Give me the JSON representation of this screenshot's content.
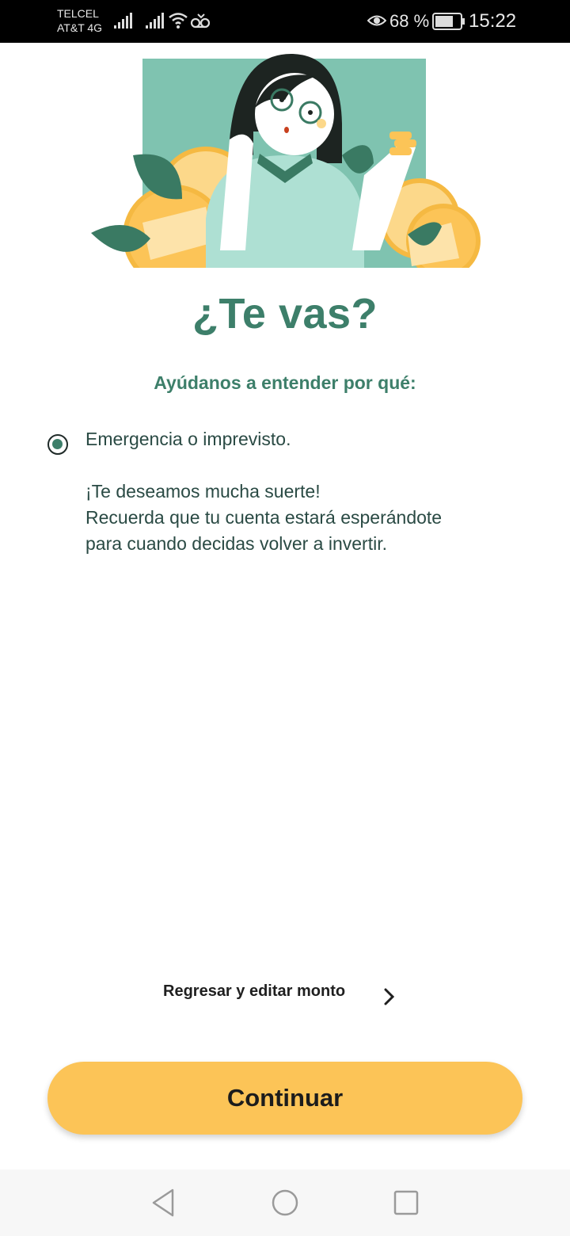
{
  "status_bar": {
    "carrier_1": "TELCEL",
    "carrier_2": "AT&T 4G",
    "battery_percent": "68 %",
    "time": "15:22",
    "icons": [
      "signal-icon",
      "signal-icon",
      "wifi-icon",
      "voicemail-icon",
      "eye-icon",
      "battery-icon"
    ]
  },
  "header": {
    "title": "¿Te vas?",
    "subtitle": "Ayúdanos a entender por qué:"
  },
  "option": {
    "label": "Emergencia o imprevisto.",
    "selected": true
  },
  "message": {
    "line1": "¡Te deseamos mucha suerte!",
    "line2": "Recuerda que tu cuenta estará esperándote",
    "line3": "para cuando decidas volver a invertir."
  },
  "back_link": {
    "label": "Regresar y editar monto",
    "icon": "chevron-right-icon"
  },
  "continue_button": {
    "label": "Continuar"
  },
  "nav": {
    "icons": [
      "back-icon",
      "home-icon",
      "recents-icon"
    ]
  },
  "colors": {
    "brand_green": "#3d7f6a",
    "button_yellow": "#fcc457",
    "illustration_bg": "#7fc3b0",
    "coin_yellow": "#fcc457"
  }
}
